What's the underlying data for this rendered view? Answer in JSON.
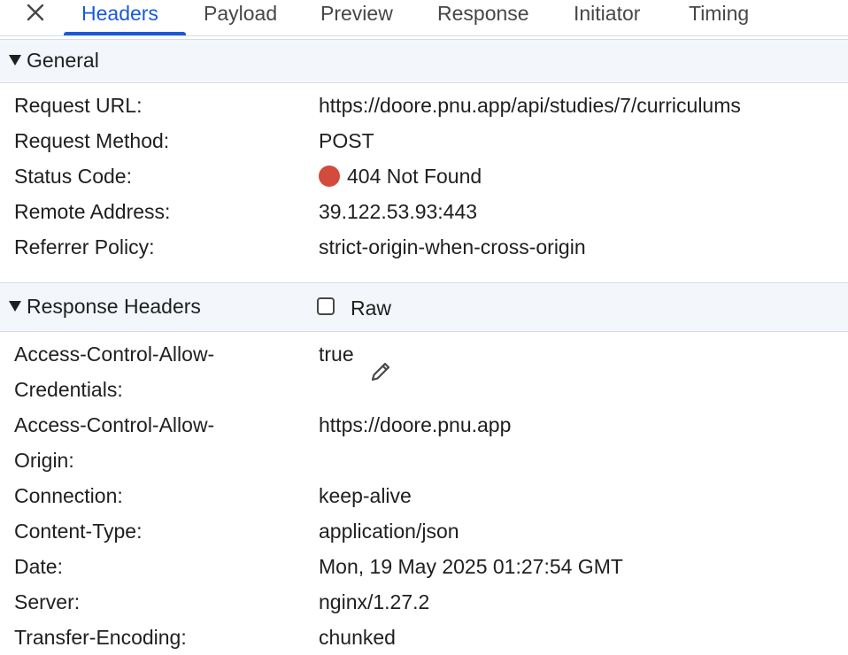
{
  "tabs": [
    {
      "label": "Headers",
      "active": true
    },
    {
      "label": "Payload",
      "active": false
    },
    {
      "label": "Preview",
      "active": false
    },
    {
      "label": "Response",
      "active": false
    },
    {
      "label": "Initiator",
      "active": false
    },
    {
      "label": "Timing",
      "active": false
    }
  ],
  "icons": {
    "close": "close-icon",
    "expand": "triangle-down-icon",
    "edit": "pencil-icon"
  },
  "colors": {
    "accent": "#1a5ad7",
    "status_error": "#d24b3d",
    "section_bg": "#f3f6fb"
  },
  "general": {
    "title": "General",
    "rows": [
      {
        "label": "Request URL:",
        "value": "https://doore.pnu.app/api/studies/7/curriculums"
      },
      {
        "label": "Request Method:",
        "value": "POST"
      },
      {
        "label": "Status Code:",
        "value": "404 Not Found"
      },
      {
        "label": "Remote Address:",
        "value": "39.122.53.93:443"
      },
      {
        "label": "Referrer Policy:",
        "value": "strict-origin-when-cross-origin"
      }
    ]
  },
  "response_headers": {
    "title": "Response Headers",
    "raw_label": "Raw",
    "raw_checked": false,
    "rows": [
      {
        "label_line1": "Access-Control-Allow-",
        "label_line2": "Credentials:",
        "value": "true"
      },
      {
        "label_line1": "Access-Control-Allow-",
        "label_line2": "Origin:",
        "value": "https://doore.pnu.app"
      },
      {
        "label": "Connection:",
        "value": "keep-alive"
      },
      {
        "label": "Content-Type:",
        "value": "application/json"
      },
      {
        "label": "Date:",
        "value": "Mon, 19 May 2025 01:27:54 GMT"
      },
      {
        "label": "Server:",
        "value": "nginx/1.27.2"
      },
      {
        "label": "Transfer-Encoding:",
        "value": "chunked"
      }
    ]
  }
}
